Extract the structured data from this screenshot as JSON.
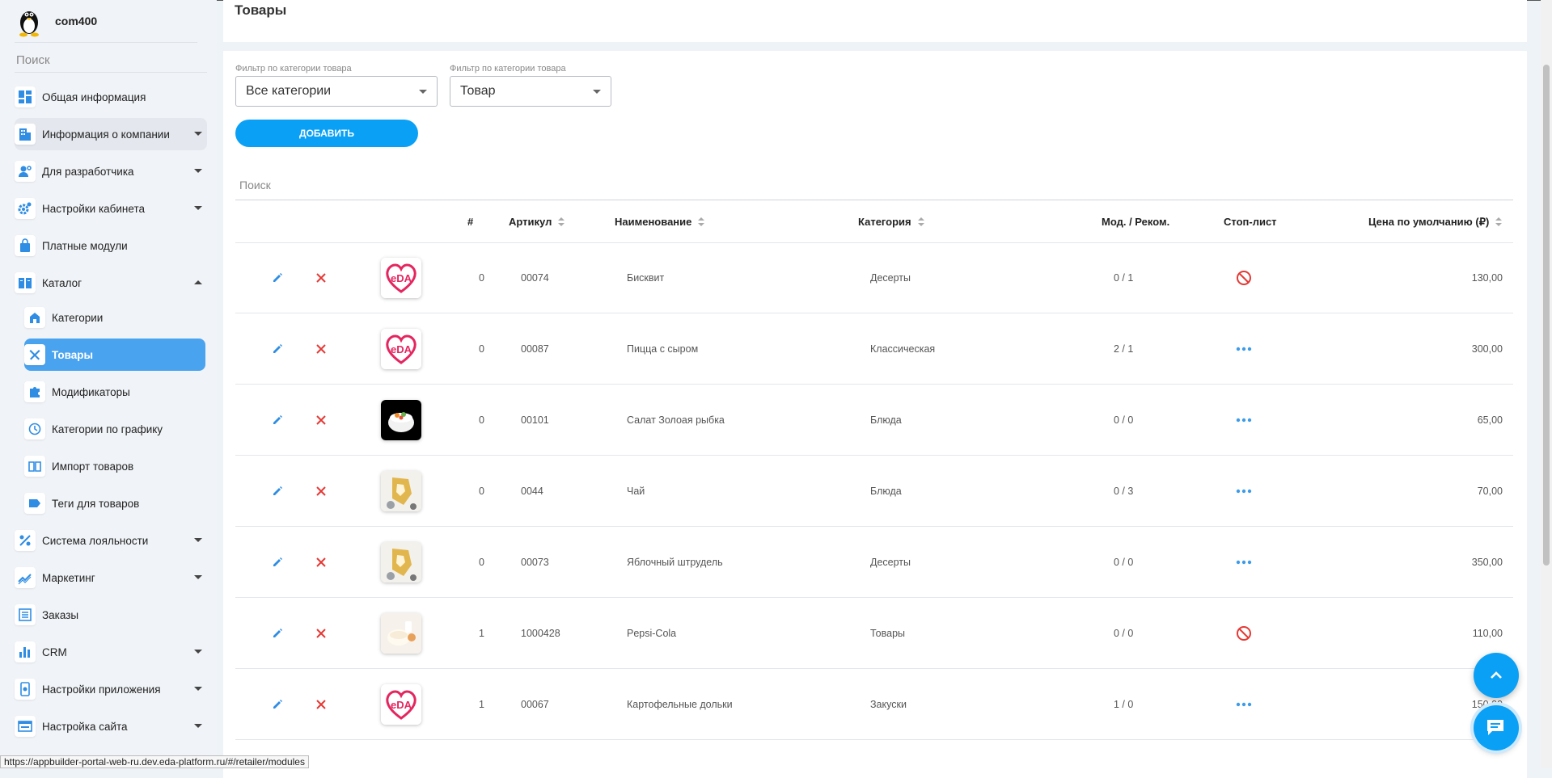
{
  "profile": {
    "name": "com400"
  },
  "sidebar": {
    "search_placeholder": "Поиск",
    "items": [
      {
        "label": "Общая информация",
        "icon": "dashboard-icon"
      },
      {
        "label": "Информация о компании",
        "icon": "building-icon"
      },
      {
        "label": "Для разработчика",
        "icon": "developer-icon"
      },
      {
        "label": "Настройки кабинета",
        "icon": "settings-gear-icon"
      },
      {
        "label": "Платные модули",
        "icon": "shopping-bag-icon"
      },
      {
        "label": "Каталог",
        "icon": "book-icon"
      },
      {
        "label": "Категории",
        "icon": "store-icon"
      },
      {
        "label": "Товары",
        "icon": "fork-knife-icon"
      },
      {
        "label": "Модификаторы",
        "icon": "puzzle-icon"
      },
      {
        "label": "Категории по графику",
        "icon": "clock-icon"
      },
      {
        "label": "Импорт товаров",
        "icon": "import-book-icon"
      },
      {
        "label": "Теги для товаров",
        "icon": "tag-icon"
      },
      {
        "label": "Система лояльности",
        "icon": "percent-icon"
      },
      {
        "label": "Маркетинг",
        "icon": "trend-icon"
      },
      {
        "label": "Заказы",
        "icon": "list-icon"
      },
      {
        "label": "CRM",
        "icon": "bar-chart-icon"
      },
      {
        "label": "Настройки приложения",
        "icon": "phone-settings-icon"
      },
      {
        "label": "Настройка сайта",
        "icon": "browser-icon"
      }
    ]
  },
  "page": {
    "title": "Товары"
  },
  "filters": {
    "category_label": "Фильтр по категории товара",
    "category_value": "Все категории",
    "type_label": "Фильтр по категории товара",
    "type_value": "Товар"
  },
  "add_button": "ДОБАВИТЬ",
  "table": {
    "search_placeholder": "Поиск",
    "headers": {
      "num": "#",
      "sku": "Артикул",
      "name": "Наименование",
      "category": "Категория",
      "mods": "Мод. / Реком.",
      "stoplist": "Стоп-лист",
      "price": "Цена по умолчанию (₽)"
    },
    "rows": [
      {
        "num": "0",
        "sku": "00074",
        "name": "Бисквит",
        "category": "Десерты",
        "mods": "0 / 1",
        "stop": "blocked",
        "price": "130,00",
        "img": "eda"
      },
      {
        "num": "0",
        "sku": "00087",
        "name": "Пицца с сыром",
        "category": "Классическая",
        "mods": "2 / 1",
        "stop": "more",
        "price": "300,00",
        "img": "eda"
      },
      {
        "num": "0",
        "sku": "00101",
        "name": "Салат Золоая рыбка",
        "category": "Блюда",
        "mods": "0 / 0",
        "stop": "more",
        "price": "65,00",
        "img": "salad"
      },
      {
        "num": "0",
        "sku": "0044",
        "name": "Чай",
        "category": "Блюда",
        "mods": "0 / 3",
        "stop": "more",
        "price": "70,00",
        "img": "pastry"
      },
      {
        "num": "0",
        "sku": "00073",
        "name": "Яблочный штрудель",
        "category": "Десерты",
        "mods": "0 / 0",
        "stop": "more",
        "price": "350,00",
        "img": "pastry"
      },
      {
        "num": "1",
        "sku": "1000428",
        "name": "Pepsi-Cola",
        "category": "Товары",
        "mods": "0 / 0",
        "stop": "blocked",
        "price": "110,00",
        "img": "milk"
      },
      {
        "num": "1",
        "sku": "00067",
        "name": "Картофельные дольки",
        "category": "Закуски",
        "mods": "1 / 0",
        "stop": "more",
        "price": "150,00",
        "img": "eda"
      }
    ]
  },
  "statusbar": {
    "url": "https://appbuilder-portal-web-ru.dev.eda-platform.ru/#/retailer/modules"
  },
  "colors": {
    "accent": "#0aa0f5",
    "active_nav": "#4aa3ef",
    "danger": "#e53935",
    "link": "#3d9be9"
  }
}
